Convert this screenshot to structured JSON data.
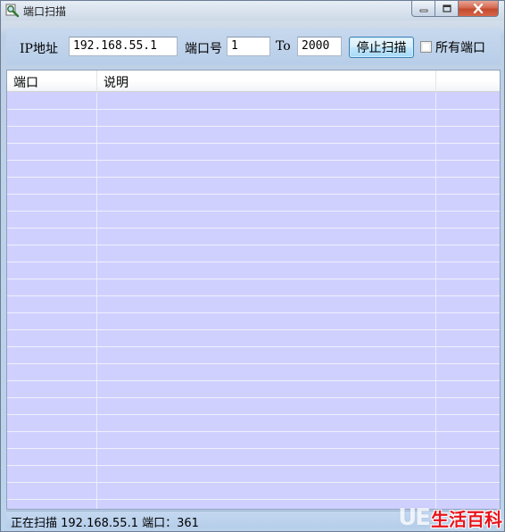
{
  "window": {
    "title": "端口扫描",
    "icon": "magnifier-icon",
    "controls": [
      "minimize-icon",
      "maximize-icon",
      "close-icon"
    ]
  },
  "toolbar": {
    "ip_label": "IP地址",
    "ip_value": "192.168.55.1",
    "port_label": "端口号",
    "port_from": "1",
    "to_label": "To",
    "port_to": "2000",
    "stop_button": "停止扫描",
    "all_ports_label": "所有端口",
    "all_ports_checked": false
  },
  "list": {
    "columns": [
      "端口",
      "说明",
      ""
    ],
    "rows": []
  },
  "status": {
    "text": "正在扫描 192.168.55.1 端口：361"
  },
  "watermark": {
    "logo": "UE",
    "text": "生活百科"
  },
  "colors": {
    "list_background": "#d0d0ff",
    "window_frame": "#bcd3ec",
    "watermark_text": "#e8141c"
  }
}
